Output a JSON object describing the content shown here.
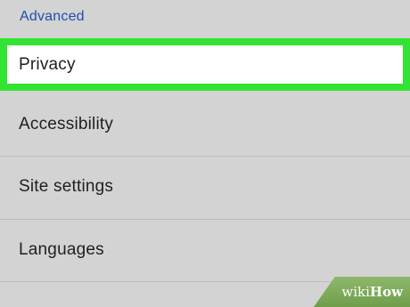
{
  "section": {
    "header": "Advanced"
  },
  "settings": {
    "items": [
      {
        "label": "Privacy",
        "highlighted": true
      },
      {
        "label": "Accessibility",
        "highlighted": false
      },
      {
        "label": "Site settings",
        "highlighted": false
      },
      {
        "label": "Languages",
        "highlighted": false
      }
    ]
  },
  "colors": {
    "background": "#d3d3d3",
    "header": "#1e4fb0",
    "highlight_border": "#32e432",
    "highlight_fill": "#ffffff",
    "watermark": "#7aa956"
  },
  "watermark": {
    "part1": "wiki",
    "part2": "How"
  }
}
